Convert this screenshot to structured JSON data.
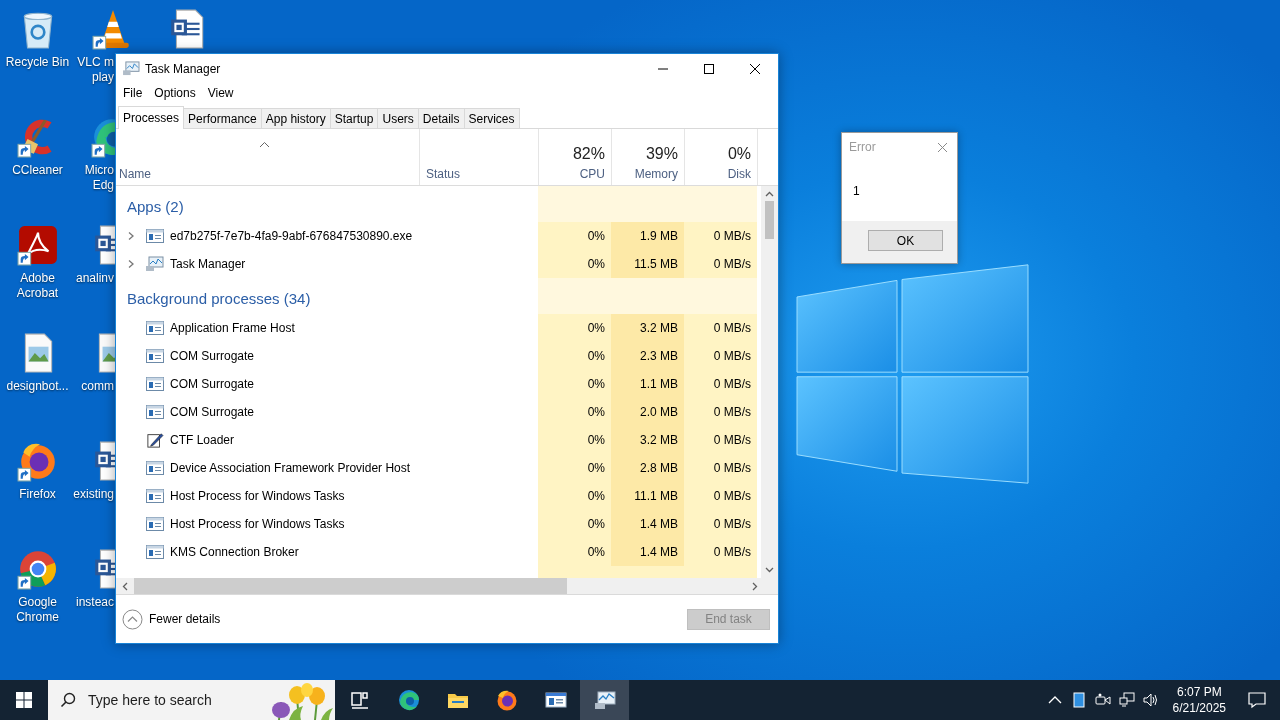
{
  "desktop": {
    "icons": [
      {
        "kind": "recycle-bin",
        "label": "Recycle Bin",
        "shortcut": false
      },
      {
        "kind": "ccleaner",
        "label": "CCleaner",
        "shortcut": true
      },
      {
        "kind": "acrobat",
        "label": "Adobe\nAcrobat",
        "shortcut": true
      },
      {
        "kind": "image-file",
        "label": "designbot...",
        "shortcut": false
      },
      {
        "kind": "firefox",
        "label": "Firefox",
        "shortcut": true
      },
      {
        "kind": "chrome",
        "label": "Google\nChrome",
        "shortcut": true
      },
      {
        "kind": "vlc",
        "label": "VLC m\nplay",
        "shortcut": true
      },
      {
        "kind": "edge",
        "label": "Micro\nEdg",
        "shortcut": true
      },
      {
        "kind": "word-doc",
        "label": "analinv",
        "shortcut": false
      },
      {
        "kind": "image-file",
        "label": "comm",
        "shortcut": false
      },
      {
        "kind": "word-doc",
        "label": "existing",
        "shortcut": false
      },
      {
        "kind": "word-doc",
        "label": "insteac",
        "shortcut": false
      },
      {
        "kind": "word-doc",
        "shortcut": false
      }
    ]
  },
  "task_manager": {
    "title": "Task Manager",
    "menu": [
      "File",
      "Options",
      "View"
    ],
    "tabs": [
      {
        "label": "Processes",
        "selected": true
      },
      {
        "label": "Performance",
        "selected": false
      },
      {
        "label": "App history",
        "selected": false
      },
      {
        "label": "Startup",
        "selected": false
      },
      {
        "label": "Users",
        "selected": false
      },
      {
        "label": "Details",
        "selected": false
      },
      {
        "label": "Services",
        "selected": false
      }
    ],
    "columns": {
      "name": "Name",
      "status": "Status",
      "cpu": {
        "percent": "82%",
        "label": "CPU"
      },
      "memory": {
        "percent": "39%",
        "label": "Memory"
      },
      "disk": {
        "percent": "0%",
        "label": "Disk"
      }
    },
    "groups": [
      {
        "title": "Apps (2)",
        "processes": [
          {
            "name": "ed7b275f-7e7b-4fa9-9abf-676847530890.exe",
            "kind": "window",
            "expandable": true,
            "cpu": "0%",
            "memory": "1.9 MB",
            "disk": "0 MB/s"
          },
          {
            "name": "Task Manager",
            "kind": "task-manager",
            "expandable": true,
            "cpu": "0%",
            "memory": "11.5 MB",
            "disk": "0 MB/s"
          }
        ]
      },
      {
        "title": "Background processes (34)",
        "processes": [
          {
            "name": "Application Frame Host",
            "kind": "window",
            "expandable": false,
            "cpu": "0%",
            "memory": "3.2 MB",
            "disk": "0 MB/s"
          },
          {
            "name": "COM Surrogate",
            "kind": "window",
            "expandable": false,
            "cpu": "0%",
            "memory": "2.3 MB",
            "disk": "0 MB/s"
          },
          {
            "name": "COM Surrogate",
            "kind": "window",
            "expandable": false,
            "cpu": "0%",
            "memory": "1.1 MB",
            "disk": "0 MB/s"
          },
          {
            "name": "COM Surrogate",
            "kind": "window",
            "expandable": false,
            "cpu": "0%",
            "memory": "2.0 MB",
            "disk": "0 MB/s"
          },
          {
            "name": "CTF Loader",
            "kind": "pen",
            "expandable": false,
            "cpu": "0%",
            "memory": "3.2 MB",
            "disk": "0 MB/s"
          },
          {
            "name": "Device Association Framework Provider Host",
            "kind": "window",
            "expandable": false,
            "cpu": "0%",
            "memory": "2.8 MB",
            "disk": "0 MB/s"
          },
          {
            "name": "Host Process for Windows Tasks",
            "kind": "window",
            "expandable": false,
            "cpu": "0%",
            "memory": "11.1 MB",
            "disk": "0 MB/s"
          },
          {
            "name": "Host Process for Windows Tasks",
            "kind": "window",
            "expandable": false,
            "cpu": "0%",
            "memory": "1.4 MB",
            "disk": "0 MB/s"
          },
          {
            "name": "KMS Connection Broker",
            "kind": "window",
            "expandable": false,
            "cpu": "0%",
            "memory": "1.4 MB",
            "disk": "0 MB/s"
          }
        ]
      }
    ],
    "footer": {
      "details_link": "Fewer details",
      "end_task": {
        "label": "End task",
        "disabled": true
      }
    }
  },
  "error_dialog": {
    "title": "Error",
    "message": "1",
    "button": "OK"
  },
  "taskbar": {
    "search": {
      "placeholder": "Type here to search"
    },
    "apps": [
      {
        "kind": "task-view",
        "active": false
      },
      {
        "kind": "edge",
        "active": false
      },
      {
        "kind": "explorer",
        "active": false
      },
      {
        "kind": "firefox",
        "active": false
      },
      {
        "kind": "app-window",
        "active": false
      },
      {
        "kind": "task-manager",
        "active": true
      }
    ],
    "clock": {
      "time": "6:07 PM",
      "date": "6/21/2025"
    }
  }
}
